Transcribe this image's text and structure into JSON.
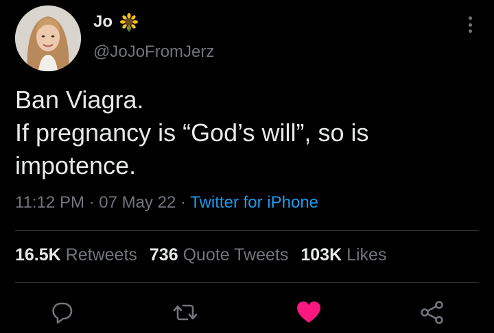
{
  "user": {
    "display_name": "Jo",
    "badge_icon": "sunflower-icon",
    "handle": "@JoJoFromJerz"
  },
  "tweet": {
    "lines": [
      "Ban Viagra.",
      "If pregnancy is “God’s will”, so is",
      "impotence."
    ]
  },
  "meta": {
    "time": "11:12 PM",
    "separator1": " · ",
    "date": "07 May 22",
    "separator2": " · ",
    "source": "Twitter for iPhone"
  },
  "stats": {
    "retweets_count": "16.5K",
    "retweets_label": "Retweets",
    "quotes_count": "736",
    "quotes_label": "Quote Tweets",
    "likes_count": "103K",
    "likes_label": "Likes"
  },
  "actions": {
    "reply_icon": "reply-icon",
    "retweet_icon": "retweet-icon",
    "like_icon": "heart-icon",
    "share_icon": "share-icon",
    "like_color": "#f91880",
    "icon_color": "#71767b",
    "link_color": "#1d9bf0"
  }
}
